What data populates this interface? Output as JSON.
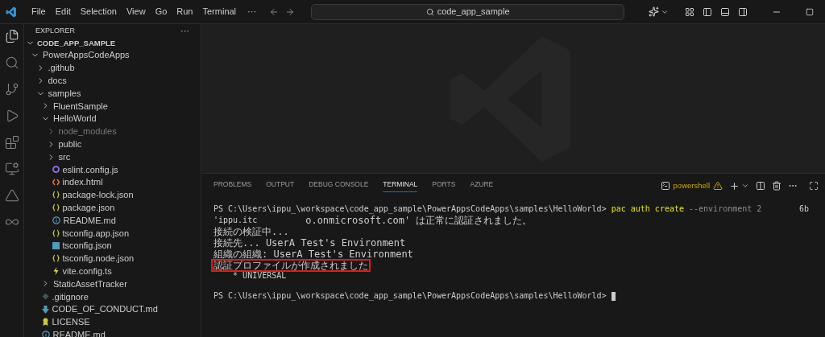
{
  "title_bar": {
    "menus": [
      "File",
      "Edit",
      "Selection",
      "View",
      "Go",
      "Run",
      "Terminal"
    ],
    "more": "···",
    "search": "code_app_sample"
  },
  "activity_bar": [
    {
      "kind": "files",
      "selected": true
    },
    {
      "kind": "search",
      "selected": false
    },
    {
      "kind": "source-control",
      "selected": false
    },
    {
      "kind": "run",
      "selected": false
    },
    {
      "kind": "extensions",
      "selected": false
    },
    {
      "kind": "remote",
      "selected": false
    },
    {
      "kind": "azure",
      "selected": false
    },
    {
      "kind": "copilot",
      "selected": false
    }
  ],
  "explorer": {
    "title": "EXPLORER",
    "more": "···",
    "root": {
      "label": "CODE_APP_SAMPLE",
      "expanded": true
    },
    "tree": [
      {
        "label": "PowerAppsCodeApps",
        "kind": "folder",
        "expanded": true,
        "dimmed": false,
        "children": [
          {
            "label": ".github",
            "kind": "folder",
            "expanded": false,
            "dimmed": false
          },
          {
            "label": "docs",
            "kind": "folder",
            "expanded": false,
            "dimmed": false
          },
          {
            "label": "samples",
            "kind": "folder",
            "expanded": true,
            "dimmed": false,
            "children": [
              {
                "label": "FluentSample",
                "kind": "folder",
                "expanded": false,
                "dimmed": false
              },
              {
                "label": "HelloWorld",
                "kind": "folder",
                "expanded": true,
                "dimmed": false,
                "children": [
                  {
                    "label": "node_modules",
                    "kind": "folder",
                    "expanded": false,
                    "dimmed": true
                  },
                  {
                    "label": "public",
                    "kind": "folder",
                    "expanded": false,
                    "dimmed": false
                  },
                  {
                    "label": "src",
                    "kind": "folder",
                    "expanded": false,
                    "dimmed": false
                  },
                  {
                    "label": "eslint.config.js",
                    "kind": "eslint",
                    "dimmed": false
                  },
                  {
                    "label": "index.html",
                    "kind": "html",
                    "dimmed": false
                  },
                  {
                    "label": "package-lock.json",
                    "kind": "json",
                    "dimmed": false
                  },
                  {
                    "label": "package.json",
                    "kind": "json",
                    "dimmed": false
                  },
                  {
                    "label": "README.md",
                    "kind": "info",
                    "dimmed": false
                  },
                  {
                    "label": "tsconfig.app.json",
                    "kind": "json",
                    "dimmed": false
                  },
                  {
                    "label": "tsconfig.json",
                    "kind": "ts",
                    "dimmed": false
                  },
                  {
                    "label": "tsconfig.node.json",
                    "kind": "json",
                    "dimmed": false
                  },
                  {
                    "label": "vite.config.ts",
                    "kind": "vite",
                    "dimmed": false
                  }
                ]
              },
              {
                "label": "StaticAssetTracker",
                "kind": "folder",
                "expanded": false,
                "dimmed": false
              }
            ]
          },
          {
            "label": ".gitignore",
            "kind": "git",
            "dimmed": false
          },
          {
            "label": "CODE_OF_CONDUCT.md",
            "kind": "download",
            "dimmed": false
          },
          {
            "label": "LICENSE",
            "kind": "license",
            "dimmed": false
          },
          {
            "label": "README.md",
            "kind": "info",
            "dimmed": false
          }
        ]
      }
    ]
  },
  "panel": {
    "tabs": [
      {
        "label": "PROBLEMS",
        "selected": false
      },
      {
        "label": "OUTPUT",
        "selected": false
      },
      {
        "label": "DEBUG CONSOLE",
        "selected": false
      },
      {
        "label": "TERMINAL",
        "selected": true
      },
      {
        "label": "PORTS",
        "selected": false
      },
      {
        "label": "AZURE",
        "selected": false
      }
    ],
    "shell": "powershell",
    "lines": [
      {
        "highlighted": false,
        "cursor": false,
        "segments": [
          {
            "text": "PS C:\\Users\\ippu_\\workspace\\code_app_sample\\PowerAppsCodeApps\\samples\\HelloWorld> ",
            "kind": "plain"
          },
          {
            "text": "pac auth create",
            "kind": "command"
          },
          {
            "text": " --environment 2",
            "kind": "flag"
          },
          {
            "text": "6b",
            "kind": "right"
          }
        ]
      },
      {
        "highlighted": false,
        "cursor": false,
        "segments": [
          {
            "text": "'ippu.itc",
            "kind": "plain"
          },
          {
            "text": "o.onmicrosoft.com' は正常に認証されました。",
            "kind": "after-gap"
          }
        ]
      },
      {
        "highlighted": false,
        "cursor": false,
        "segments": [
          {
            "text": "接続の検証中...",
            "kind": "plain"
          }
        ]
      },
      {
        "highlighted": false,
        "cursor": false,
        "segments": [
          {
            "text": "接続先... UserA Test's Environment",
            "kind": "plain"
          }
        ]
      },
      {
        "highlighted": false,
        "cursor": false,
        "segments": [
          {
            "text": "組織の組織: UserA Test's Environment",
            "kind": "plain"
          }
        ]
      },
      {
        "highlighted": true,
        "cursor": false,
        "segments": [
          {
            "text": "認証プロファイルが作成されました",
            "kind": "plain"
          }
        ]
      },
      {
        "highlighted": false,
        "cursor": false,
        "segments": [
          {
            "text": "    * UNIVERSAL",
            "kind": "plain"
          }
        ]
      },
      {
        "highlighted": false,
        "cursor": true,
        "segments": [
          {
            "text": "PS C:\\Users\\ippu_\\workspace\\code_app_sample\\PowerAppsCodeApps\\samples\\HelloWorld> ",
            "kind": "plain"
          }
        ]
      }
    ]
  }
}
